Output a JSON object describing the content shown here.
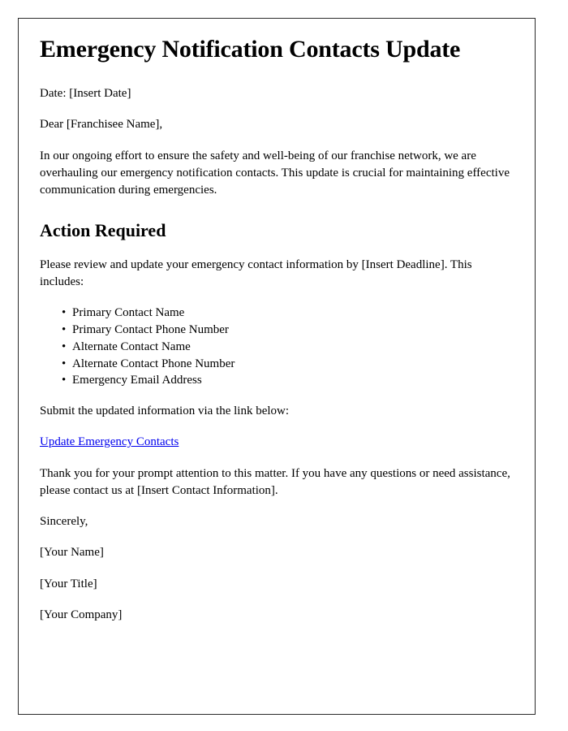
{
  "document": {
    "title": "Emergency Notification Contacts Update",
    "date_line": "Date: [Insert Date]",
    "salutation": "Dear [Franchisee Name],",
    "intro_paragraph": "In our ongoing effort to ensure the safety and well-being of our franchise network, we are overhauling our emergency notification contacts. This update is crucial for maintaining effective communication during emergencies.",
    "action_heading": "Action Required",
    "action_paragraph": "Please review and update your emergency contact information by [Insert Deadline]. This includes:",
    "bullet_marker": "•",
    "bullets": [
      "Primary Contact Name",
      "Primary Contact Phone Number",
      "Alternate Contact Name",
      "Alternate Contact Phone Number",
      "Emergency Email Address"
    ],
    "submit_paragraph": "Submit the updated information via the link below:",
    "link_text": "Update Emergency Contacts",
    "link_color": "#0000ee",
    "closing_paragraph": "Thank you for your prompt attention to this matter. If you have any questions or need assistance, please contact us at [Insert Contact Information].",
    "signoff": "Sincerely,",
    "signature_name": "[Your Name]",
    "signature_title": "[Your Title]",
    "signature_company": "[Your Company]",
    "border_color": "#2b2b2b",
    "text_color": "#000000"
  }
}
